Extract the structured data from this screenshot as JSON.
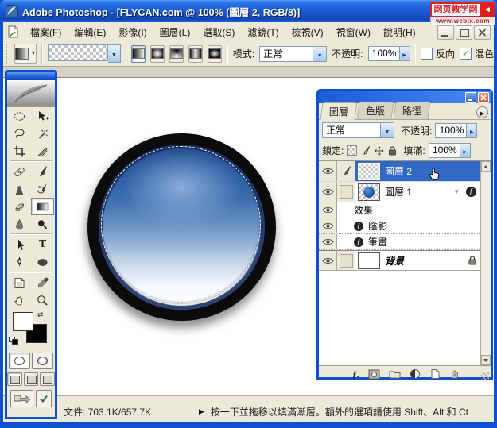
{
  "window": {
    "title": "Adobe Photoshop - [FLYCAN.com @ 100% (圖層 2, RGB/8)]"
  },
  "watermark": {
    "line1": "网页教学网",
    "line2": "www.webjx.com",
    "arrow": "◄"
  },
  "menu": {
    "items": [
      "檔案(F)",
      "編輯(E)",
      "影像(I)",
      "圖層(L)",
      "選取(S)",
      "濾鏡(T)",
      "檢視(V)",
      "視窗(W)",
      "說明(H)"
    ]
  },
  "options": {
    "mode_label": "模式:",
    "mode_value": "正常",
    "opacity_label": "不透明:",
    "opacity_value": "100%",
    "reverse_label": "反向",
    "dither_label": "混色"
  },
  "layers_panel": {
    "tabs": [
      "圖層",
      "色版",
      "路徑"
    ],
    "blend_mode": "正常",
    "opacity_label": "不透明:",
    "opacity_value": "100%",
    "lock_label": "鎖定:",
    "fill_label": "填滿:",
    "fill_value": "100%",
    "layers": {
      "layer2": "圖層 2",
      "layer1": "圖層 1",
      "effects": "效果",
      "shadow": "陰影",
      "stroke": "筆畫",
      "background": "背景"
    }
  },
  "status": {
    "zoom": "100%",
    "doc": "文件: 703.1K/657.7K",
    "hint": "按一下並拖移以填滿漸層。額外的選項請使用 Shift、Alt 和 Ct"
  },
  "glyphs": {
    "combo_arrow": "▼",
    "spinner_arrow": "▶",
    "panel_menu": "▶",
    "layer_expand": "▼",
    "fx": "ƒ",
    "fx_dot": "ƒ.",
    "check": "✓",
    "hint_arrow": "▶",
    "type_tool": "T",
    "swap": "⇄"
  },
  "colors": {
    "selection": "#316ac5",
    "titlebar_blue": "#1b5cd8",
    "panel_beige": "#ece9d8",
    "circle_navy": "#1b4486"
  }
}
